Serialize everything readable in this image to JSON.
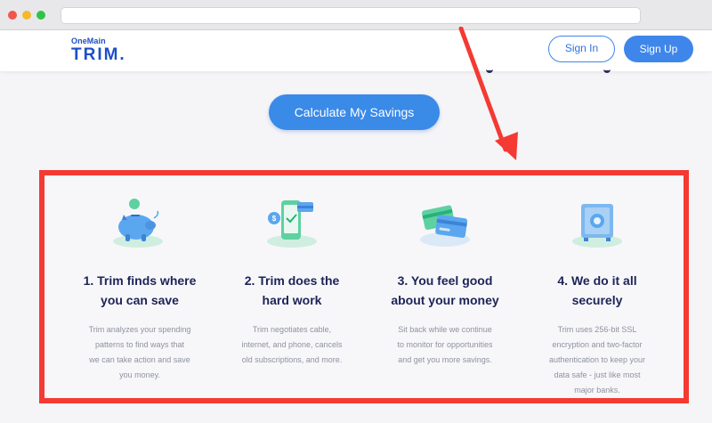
{
  "header": {
    "logo_small": "OneMain",
    "logo_big": "TRIM.",
    "signin_label": "Sign In",
    "signup_label": "Sign Up"
  },
  "cta": {
    "label": "Calculate My Savings"
  },
  "features": [
    {
      "icon": "piggy-bank-icon",
      "title_line1": "1. Trim finds where",
      "title_line2": "you can save",
      "desc": [
        "Trim analyzes your spending",
        "patterns to find ways that",
        "we can take action and save",
        "you money."
      ]
    },
    {
      "icon": "phone-bill-icon",
      "title_line1": "2. Trim does the",
      "title_line2": "hard work",
      "desc": [
        "Trim negotiates cable,",
        "internet, and phone, cancels",
        "old subscriptions, and more."
      ]
    },
    {
      "icon": "credit-cards-icon",
      "title_line1": "3. You feel good",
      "title_line2": "about your money",
      "desc": [
        "Sit back while we continue",
        "to monitor for opportunities",
        "and get you more savings."
      ]
    },
    {
      "icon": "safe-icon",
      "title_line1": "4. We do it all",
      "title_line2": "securely",
      "desc": [
        "Trim uses 256-bit SSL",
        "encryption and two-factor",
        "authentication to keep your",
        "data safe - just like most",
        "major banks."
      ]
    }
  ],
  "colors": {
    "brand": "#1d4fc8",
    "accent": "#3a8ae8",
    "highlight_border": "#f43a33",
    "heading": "#1d2356",
    "body_text": "#8e929e"
  }
}
